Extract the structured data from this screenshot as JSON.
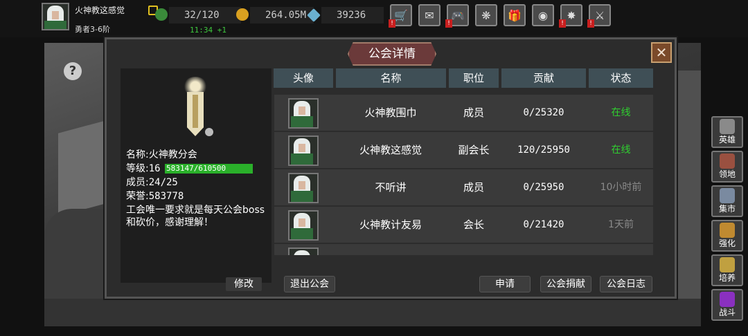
{
  "player": {
    "name": "火神教这感觉",
    "rank": "勇者3-6阶"
  },
  "resources": {
    "energy": "32/120",
    "energy_timer": "11:34 +1",
    "gold": "264.05M",
    "gems": "39236"
  },
  "top_menu": [
    {
      "icon": "shop-cart-icon",
      "glyph": "🛒",
      "badge": "!"
    },
    {
      "icon": "mail-icon",
      "glyph": "✉",
      "badge": ""
    },
    {
      "icon": "gamepad-icon",
      "glyph": "🎮",
      "badge": "!"
    },
    {
      "icon": "gear-icon",
      "glyph": "❋",
      "badge": ""
    },
    {
      "icon": "gift-icon",
      "glyph": "🎁",
      "badge": ""
    },
    {
      "icon": "color-wheel-icon",
      "glyph": "◉",
      "badge": ""
    },
    {
      "icon": "fireworks-icon",
      "glyph": "✸",
      "badge": "!"
    },
    {
      "icon": "crossed-swords-icon",
      "glyph": "⚔",
      "badge": "!"
    }
  ],
  "side_menu": [
    {
      "label": "英雄",
      "icon": "hero-helmet-icon",
      "color": "#8a8a8a"
    },
    {
      "label": "领地",
      "icon": "territory-castle-icon",
      "color": "#9a5040"
    },
    {
      "label": "集市",
      "icon": "market-stall-icon",
      "color": "#7a8aa0"
    },
    {
      "label": "强化",
      "icon": "enhance-crystal-icon",
      "color": "#c08a30"
    },
    {
      "label": "培养",
      "icon": "train-trophy-icon",
      "color": "#c0a040"
    },
    {
      "label": "战斗",
      "icon": "battle-portal-icon",
      "color": "#8a30c0"
    }
  ],
  "modal": {
    "title": "公会详情",
    "close_glyph": "✕"
  },
  "guild": {
    "name_label": "名称:",
    "name": "火神教分会",
    "level_label": "等级:",
    "level": "16",
    "exp": "583147/610500",
    "members_label": "成员:",
    "members": "24/25",
    "honor_label": "荣誉:",
    "honor": "583778",
    "notice": "工会唯一要求就是每天公会boss和砍价，感谢理解！",
    "modify_label": "修改"
  },
  "table": {
    "headers": {
      "avatar": "头像",
      "name": "名称",
      "role": "职位",
      "contribution": "贡献",
      "status": "状态"
    }
  },
  "members": [
    {
      "name": "火神教围巾",
      "role": "成员",
      "contribution": "0/25320",
      "status": "在线",
      "status_color": "#2fd02f"
    },
    {
      "name": "火神教这感觉",
      "role": "副会长",
      "contribution": "120/25950",
      "status": "在线",
      "status_color": "#2fd02f"
    },
    {
      "name": "不听讲",
      "role": "成员",
      "contribution": "0/25950",
      "status": "10小时前",
      "status_color": "#8a8a8a"
    },
    {
      "name": "火神教计友易",
      "role": "会长",
      "contribution": "0/21420",
      "status": "1天前",
      "status_color": "#8a8a8a"
    }
  ],
  "buttons": {
    "leave": "退出公会",
    "apply": "申请",
    "donate": "公会捐献",
    "log": "公会日志"
  },
  "help_glyph": "?"
}
